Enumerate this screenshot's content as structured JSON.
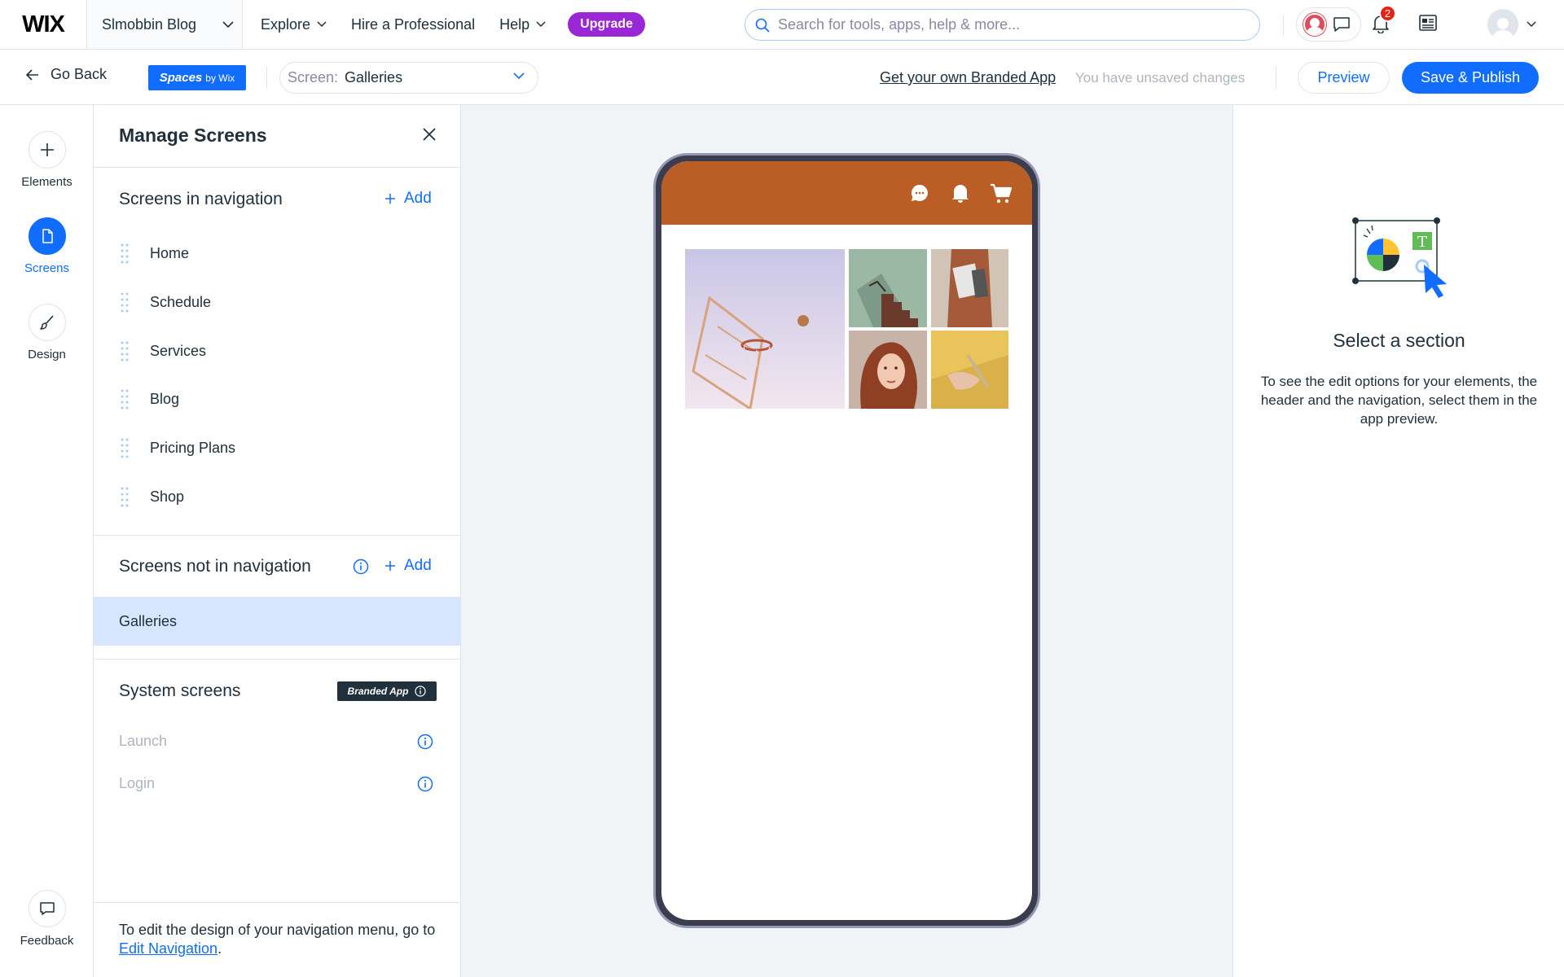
{
  "topbar": {
    "logo": "WIX",
    "site_name": "Slmobbin Blog",
    "nav": [
      "Explore",
      "Hire a Professional",
      "Help"
    ],
    "upgrade_label": "Upgrade",
    "search_placeholder": "Search for tools, apps, help & more...",
    "notification_count": "2"
  },
  "subbar": {
    "go_back": "Go Back",
    "spaces_brand": "Spaces",
    "spaces_by": "by Wix",
    "screen_label": "Screen:",
    "screen_value": "Galleries",
    "branded_app_link": "Get your own Branded App",
    "unsaved_text": "You have unsaved changes",
    "preview_label": "Preview",
    "publish_label": "Save & Publish"
  },
  "rail": {
    "items": [
      {
        "label": "Elements",
        "icon": "plus-icon"
      },
      {
        "label": "Screens",
        "icon": "page-icon",
        "active": true
      },
      {
        "label": "Design",
        "icon": "brush-icon"
      }
    ],
    "feedback_label": "Feedback"
  },
  "panel": {
    "title": "Manage Screens",
    "in_nav_title": "Screens in navigation",
    "add_label": "Add",
    "nav_screens": [
      "Home",
      "Schedule",
      "Services",
      "Blog",
      "Pricing Plans",
      "Shop"
    ],
    "not_in_nav_title": "Screens not in navigation",
    "not_in_nav_screens": [
      "Galleries"
    ],
    "system_title": "System screens",
    "branded_tag": "Branded App",
    "system_screens": [
      "Launch",
      "Login"
    ],
    "footer_text": "To edit the design of your navigation menu, go to ",
    "footer_link": "Edit Navigation",
    "footer_end": "."
  },
  "preview": {
    "header_color": "#ba5e25"
  },
  "right_panel": {
    "title": "Select a section",
    "description": "To see the edit options for your elements, the header and the navigation, select them in the app preview."
  },
  "colors": {
    "accent": "#116dff",
    "upgrade": "#9a27d5",
    "selected_row": "#d6e6fe"
  }
}
